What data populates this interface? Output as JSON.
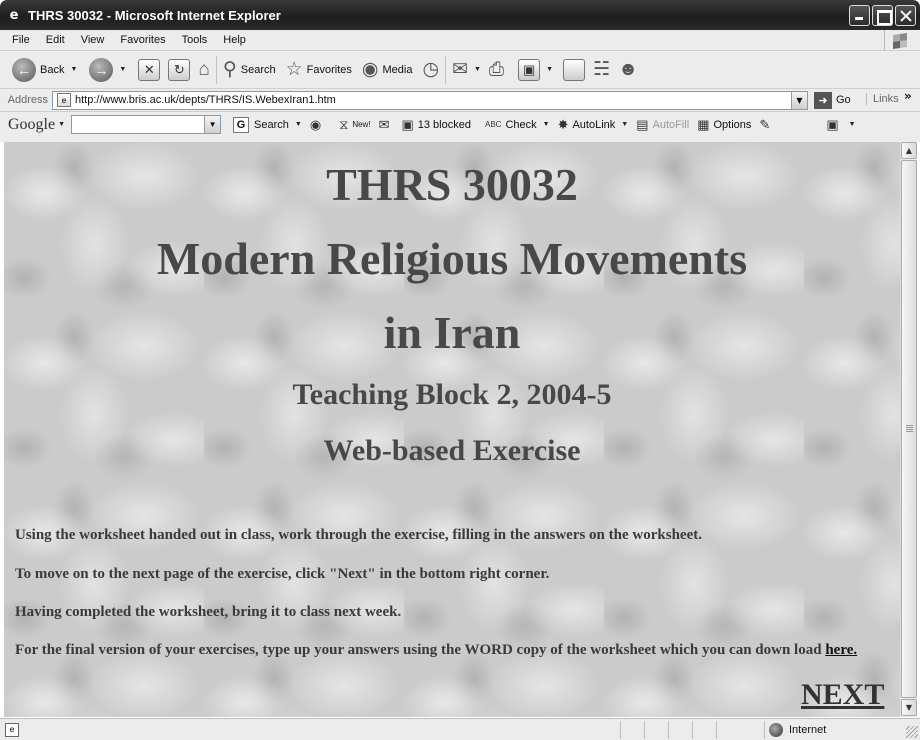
{
  "window": {
    "title": "THRS 30032 - Microsoft Internet Explorer"
  },
  "menu": {
    "items": [
      "File",
      "Edit",
      "View",
      "Favorites",
      "Tools",
      "Help"
    ]
  },
  "toolbar": {
    "back": "Back",
    "search": "Search",
    "favorites": "Favorites",
    "media": "Media"
  },
  "address": {
    "label": "Address",
    "url": "http://www.bris.ac.uk/depts/THRS/IS.WebexIran1.htm",
    "go": "Go",
    "links": "Links"
  },
  "google": {
    "logo": "Google",
    "search": "Search",
    "new_label": "New!",
    "blocked": "13 blocked",
    "check": "Check",
    "check_badge": "ABC",
    "autolink": "AutoLink",
    "autofill": "AutoFill",
    "options": "Options"
  },
  "page": {
    "course_code": "THRS 30032",
    "title_line1": "Modern Religious Movements",
    "title_line2": "in Iran",
    "block": "Teaching Block 2, 2004-5",
    "exercise": "Web-based Exercise",
    "para1": "Using the worksheet handed out in class, work through the exercise, filling in the answers on the worksheet.",
    "para2": "To move on to the next page of the exercise, click \"Next\" in the bottom right corner.",
    "para3": "Having completed the worksheet, bring it to class next week.",
    "para4": "For the final version of your exercises, type up your answers using the WORD copy of the worksheet which you can down load ",
    "here_link": "here.",
    "next_link": "NEXT"
  },
  "status": {
    "zone": "Internet"
  }
}
